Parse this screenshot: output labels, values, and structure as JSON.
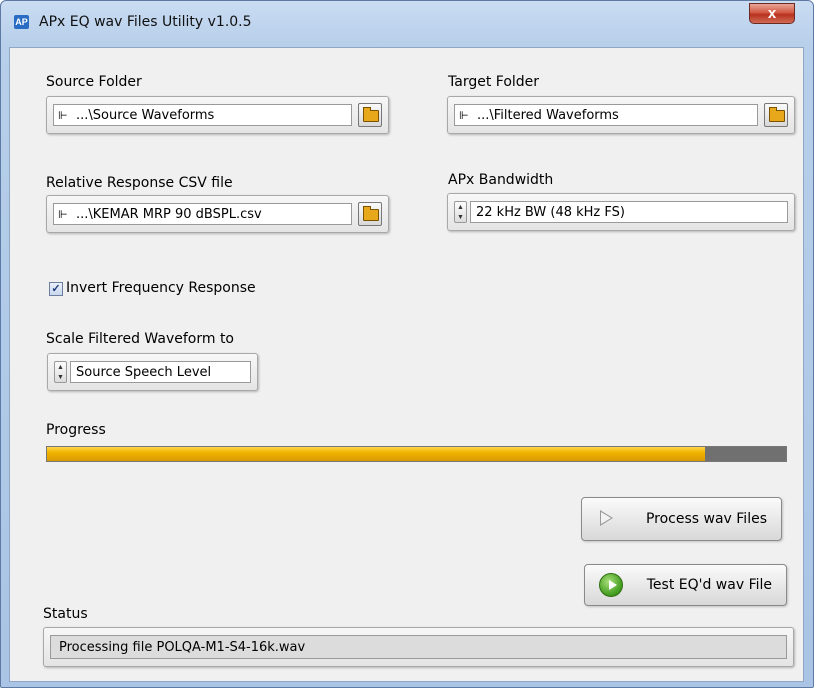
{
  "window": {
    "title": "APx EQ wav Files Utility v1.0.5",
    "app_icon_text": "AP",
    "close_glyph": "x"
  },
  "source_folder": {
    "label": "Source Folder",
    "value": "...\\Source Waveforms"
  },
  "target_folder": {
    "label": "Target Folder",
    "value": "...\\Filtered Waveforms"
  },
  "csv_file": {
    "label": "Relative Response CSV file",
    "value": "...\\KEMAR MRP 90 dBSPL.csv"
  },
  "bandwidth": {
    "label": "APx Bandwidth",
    "value": "22 kHz BW  (48 kHz FS)"
  },
  "invert": {
    "label": "Invert Frequency Response",
    "checked": true,
    "check_glyph": "✓"
  },
  "scale": {
    "label": "Scale Filtered Waveform to",
    "value": "Source Speech Level"
  },
  "progress": {
    "label": "Progress",
    "fraction": 0.89
  },
  "buttons": {
    "process": {
      "label": "Process wav Files",
      "icon": "play-icon"
    },
    "test": {
      "label": "Test EQ'd wav File",
      "icon": "refresh-icon"
    }
  },
  "status": {
    "label": "Status",
    "value": "Processing file POLQA-M1-S4-16k.wav"
  },
  "icons": {
    "path": "path-icon",
    "browse": "folder-icon",
    "spinner_up": "▲",
    "spinner_down": "▼",
    "path_glyph": "⊩"
  },
  "colors": {
    "progress_fill": "#f0b400",
    "progress_track": "#707070",
    "close_button": "#c9422d"
  }
}
